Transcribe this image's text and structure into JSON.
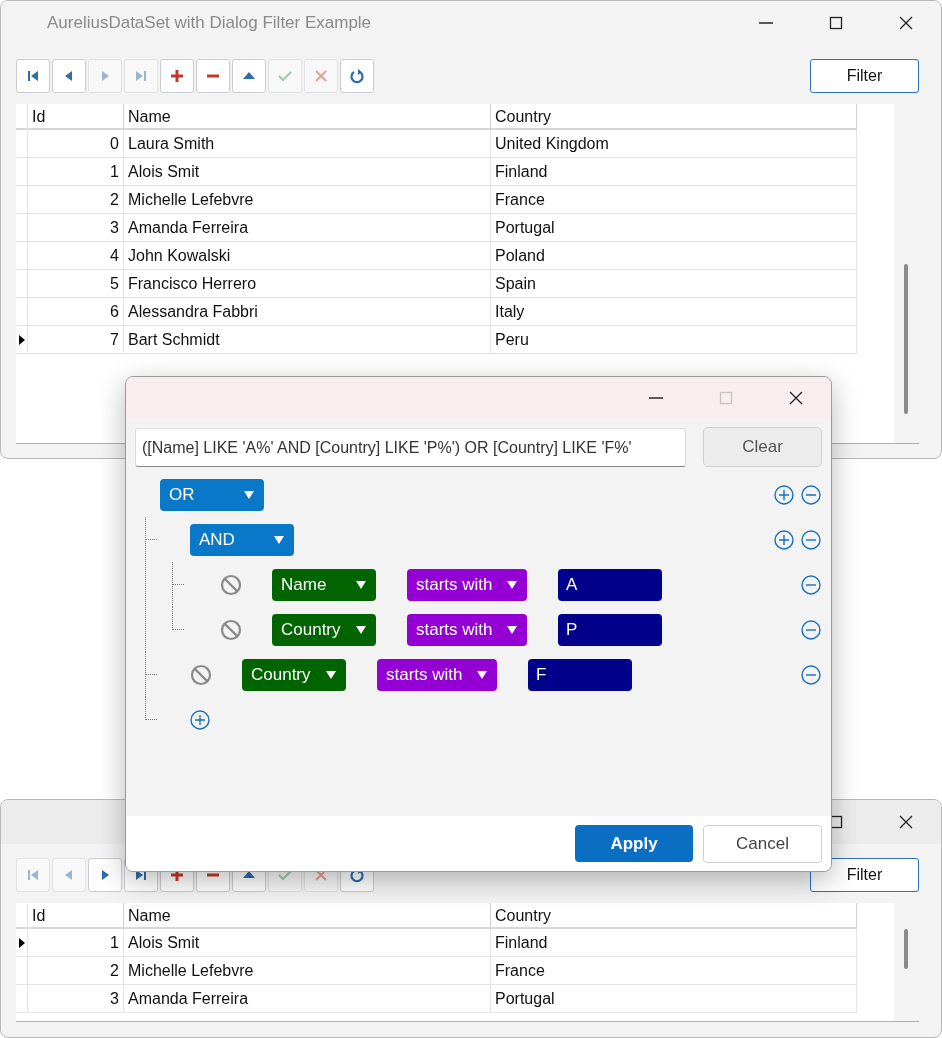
{
  "main_window": {
    "title": "AureliusDataSet with Dialog Filter Example",
    "toolbar": [
      {
        "kind": "first",
        "disabled": false
      },
      {
        "kind": "prior",
        "disabled": false
      },
      {
        "kind": "next",
        "disabled": true
      },
      {
        "kind": "last",
        "disabled": true
      },
      {
        "kind": "insert",
        "disabled": false
      },
      {
        "kind": "delete",
        "disabled": false
      },
      {
        "kind": "edit",
        "disabled": false
      },
      {
        "kind": "post",
        "disabled": true
      },
      {
        "kind": "cancel",
        "disabled": true
      },
      {
        "kind": "refresh",
        "disabled": false
      }
    ],
    "filter_button": "Filter",
    "grid": {
      "columns": [
        "Id",
        "Name",
        "Country"
      ],
      "rows": [
        {
          "id": "0",
          "name": "Laura Smith",
          "country": "United Kingdom",
          "current": false
        },
        {
          "id": "1",
          "name": "Alois Smit",
          "country": "Finland",
          "current": false
        },
        {
          "id": "2",
          "name": "Michelle Lefebvre",
          "country": "France",
          "current": false
        },
        {
          "id": "3",
          "name": "Amanda Ferreira",
          "country": "Portugal",
          "current": false
        },
        {
          "id": "4",
          "name": "John Kowalski",
          "country": "Poland",
          "current": false
        },
        {
          "id": "5",
          "name": "Francisco Herrero",
          "country": "Spain",
          "current": false
        },
        {
          "id": "6",
          "name": "Alessandra Fabbri",
          "country": "Italy",
          "current": false
        },
        {
          "id": "7",
          "name": "Bart Schmidt",
          "country": "Peru",
          "current": true
        }
      ]
    }
  },
  "second_window": {
    "toolbar": [
      {
        "kind": "first",
        "disabled": true
      },
      {
        "kind": "prior",
        "disabled": true
      },
      {
        "kind": "next",
        "disabled": false
      },
      {
        "kind": "last",
        "disabled": false
      },
      {
        "kind": "insert",
        "disabled": false
      },
      {
        "kind": "delete",
        "disabled": false
      },
      {
        "kind": "edit",
        "disabled": false
      },
      {
        "kind": "post",
        "disabled": true
      },
      {
        "kind": "cancel",
        "disabled": true
      },
      {
        "kind": "refresh",
        "disabled": false
      }
    ],
    "filter_button": "Filter",
    "grid": {
      "columns": [
        "Id",
        "Name",
        "Country"
      ],
      "rows": [
        {
          "id": "1",
          "name": "Alois Smit",
          "country": "Finland",
          "current": true
        },
        {
          "id": "2",
          "name": "Michelle Lefebvre",
          "country": "France",
          "current": false
        },
        {
          "id": "3",
          "name": "Amanda Ferreira",
          "country": "Portugal",
          "current": false
        }
      ]
    }
  },
  "filter_dialog": {
    "window_controls": [
      {
        "kind": "minimize",
        "disabled": false
      },
      {
        "kind": "maximize",
        "disabled": true
      },
      {
        "kind": "close",
        "disabled": false
      }
    ],
    "expression": "([Name] LIKE 'A%' AND [Country] LIKE 'P%') OR [Country] LIKE 'F%'",
    "clear_button": "Clear",
    "filter_tree": {
      "kind": "group",
      "operator": "OR",
      "children": [
        {
          "kind": "group",
          "operator": "AND",
          "children": [
            {
              "kind": "condition",
              "field": "Name",
              "comparison": "starts with",
              "value": "A"
            },
            {
              "kind": "condition",
              "field": "Country",
              "comparison": "starts with",
              "value": "P"
            }
          ]
        },
        {
          "kind": "condition",
          "field": "Country",
          "comparison": "starts with",
          "value": "F"
        }
      ]
    },
    "apply_button": "Apply",
    "cancel_button": "Cancel"
  }
}
